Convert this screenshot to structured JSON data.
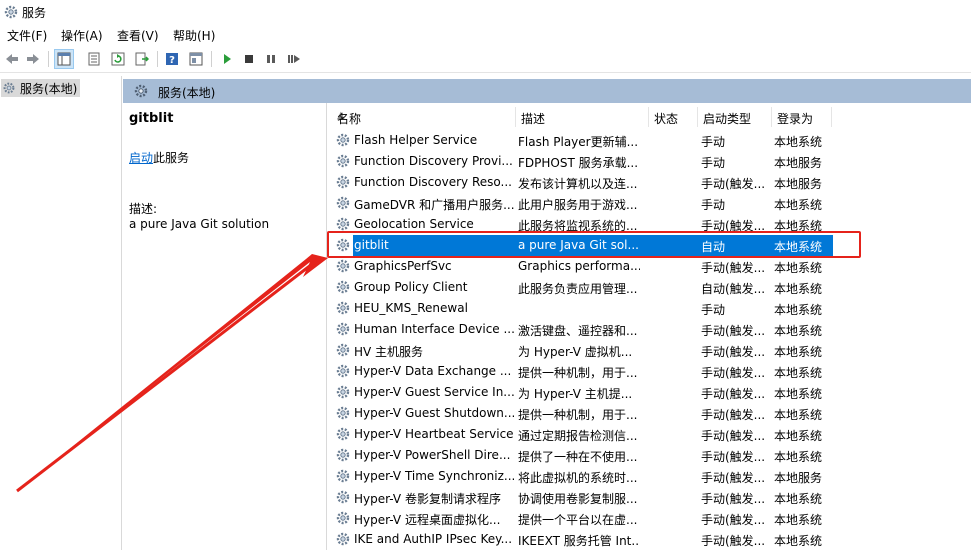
{
  "window": {
    "title": "服务"
  },
  "menu": [
    {
      "label": "文件(F)"
    },
    {
      "label": "操作(A)"
    },
    {
      "label": "查看(V)"
    },
    {
      "label": "帮助(H)"
    }
  ],
  "toolbar": {
    "buttons": [
      "back-icon",
      "forward-icon",
      "console-tree-icon",
      "properties-icon",
      "refresh-icon",
      "export-list-icon",
      "help-icon",
      "show-pane-icon",
      "start-service-icon",
      "stop-service-icon",
      "pause-service-icon",
      "restart-service-icon"
    ]
  },
  "tree": {
    "item_label": "服务(本地)"
  },
  "panel": {
    "header_title": "服务(本地)"
  },
  "details": {
    "service_name": "gitblit",
    "start_link": "启动",
    "start_suffix": "此服务",
    "description_label": "描述:",
    "description_text": "a pure Java Git solution"
  },
  "grid": {
    "columns": [
      "名称",
      "描述",
      "状态",
      "启动类型",
      "登录为"
    ],
    "rows": [
      {
        "name": "Flash Helper Service",
        "desc": "Flash Player更新辅...",
        "status": "",
        "start": "手动",
        "logon": "本地系统"
      },
      {
        "name": "Function Discovery Provi...",
        "desc": "FDPHOST 服务承载...",
        "status": "",
        "start": "手动",
        "logon": "本地服务"
      },
      {
        "name": "Function Discovery Reso...",
        "desc": "发布该计算机以及连...",
        "status": "",
        "start": "手动(触发...",
        "logon": "本地服务"
      },
      {
        "name": "GameDVR 和广播用户服务...",
        "desc": "此用户服务用于游戏...",
        "status": "",
        "start": "手动",
        "logon": "本地系统"
      },
      {
        "name": "Geolocation Service",
        "desc": "此服务将监视系统的...",
        "status": "",
        "start": "手动(触发...",
        "logon": "本地系统"
      },
      {
        "name": "gitblit",
        "desc": "a pure Java Git sol...",
        "status": "",
        "start": "自动",
        "logon": "本地系统",
        "selected": true
      },
      {
        "name": "GraphicsPerfSvc",
        "desc": "Graphics performa...",
        "status": "",
        "start": "手动(触发...",
        "logon": "本地系统"
      },
      {
        "name": "Group Policy Client",
        "desc": "此服务负责应用管理...",
        "status": "",
        "start": "自动(触发...",
        "logon": "本地系统"
      },
      {
        "name": "HEU_KMS_Renewal",
        "desc": "",
        "status": "",
        "start": "手动",
        "logon": "本地系统"
      },
      {
        "name": "Human Interface Device ...",
        "desc": "激活键盘、遥控器和...",
        "status": "",
        "start": "手动(触发...",
        "logon": "本地系统"
      },
      {
        "name": "HV 主机服务",
        "desc": "为 Hyper-V 虚拟机...",
        "status": "",
        "start": "手动(触发...",
        "logon": "本地系统"
      },
      {
        "name": "Hyper-V Data Exchange ...",
        "desc": "提供一种机制，用于...",
        "status": "",
        "start": "手动(触发...",
        "logon": "本地系统"
      },
      {
        "name": "Hyper-V Guest Service In...",
        "desc": "为 Hyper-V 主机提...",
        "status": "",
        "start": "手动(触发...",
        "logon": "本地系统"
      },
      {
        "name": "Hyper-V Guest Shutdown...",
        "desc": "提供一种机制，用于...",
        "status": "",
        "start": "手动(触发...",
        "logon": "本地系统"
      },
      {
        "name": "Hyper-V Heartbeat Service",
        "desc": "通过定期报告检测信...",
        "status": "",
        "start": "手动(触发...",
        "logon": "本地系统"
      },
      {
        "name": "Hyper-V PowerShell Dire...",
        "desc": "提供了一种在不使用...",
        "status": "",
        "start": "手动(触发...",
        "logon": "本地系统"
      },
      {
        "name": "Hyper-V Time Synchroniz...",
        "desc": "将此虚拟机的系统时...",
        "status": "",
        "start": "手动(触发...",
        "logon": "本地服务"
      },
      {
        "name": "Hyper-V 卷影复制请求程序",
        "desc": "协调使用卷影复制服...",
        "status": "",
        "start": "手动(触发...",
        "logon": "本地系统"
      },
      {
        "name": "Hyper-V 远程桌面虚拟化...",
        "desc": "提供一个平台以在虚...",
        "status": "",
        "start": "手动(触发...",
        "logon": "本地系统"
      },
      {
        "name": "IKE and AuthIP IPsec Key...",
        "desc": "IKEEXT 服务托管 Int...",
        "status": "",
        "start": "手动(触发...",
        "logon": "本地系统"
      }
    ]
  },
  "colors": {
    "selection": "#0078d7",
    "panel_header": "#a6bcd6",
    "annotation": "#e5231b"
  }
}
